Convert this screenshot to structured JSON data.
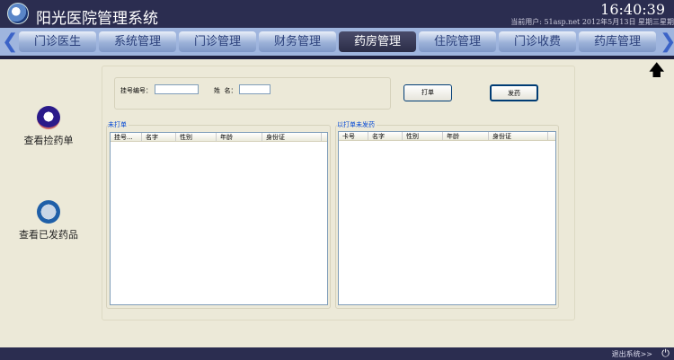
{
  "header": {
    "title": "阳光医院管理系统",
    "clock": "16:40:39",
    "user_info": "当前用户: 51asp.net 2012年5月13日 星期三星期"
  },
  "tabs": [
    {
      "label": "门诊医生"
    },
    {
      "label": "系统管理"
    },
    {
      "label": "门诊管理"
    },
    {
      "label": "财务管理"
    },
    {
      "label": "药房管理",
      "active": true
    },
    {
      "label": "住院管理"
    },
    {
      "label": "门诊收费"
    },
    {
      "label": "药库管理"
    }
  ],
  "sidebar": {
    "items": [
      {
        "label": "查看捡药单",
        "icon": "prescription-list-icon"
      },
      {
        "label": "查看已发药品",
        "icon": "dispensed-drugs-icon"
      }
    ]
  },
  "search": {
    "reg_label": "挂号编号：",
    "reg_value": "",
    "name_label": "姓  名：",
    "name_value": ""
  },
  "buttons": {
    "print": "打单",
    "dispense": "发药"
  },
  "unprinted": {
    "title": "未打单",
    "columns": [
      "挂号...",
      "名字",
      "性别",
      "年龄",
      "身份证"
    ]
  },
  "printed": {
    "title": "以打单未发药",
    "columns": [
      "卡号",
      "名字",
      "性别",
      "年龄",
      "身份证"
    ]
  },
  "footer": {
    "exit": "退出系统>>"
  }
}
